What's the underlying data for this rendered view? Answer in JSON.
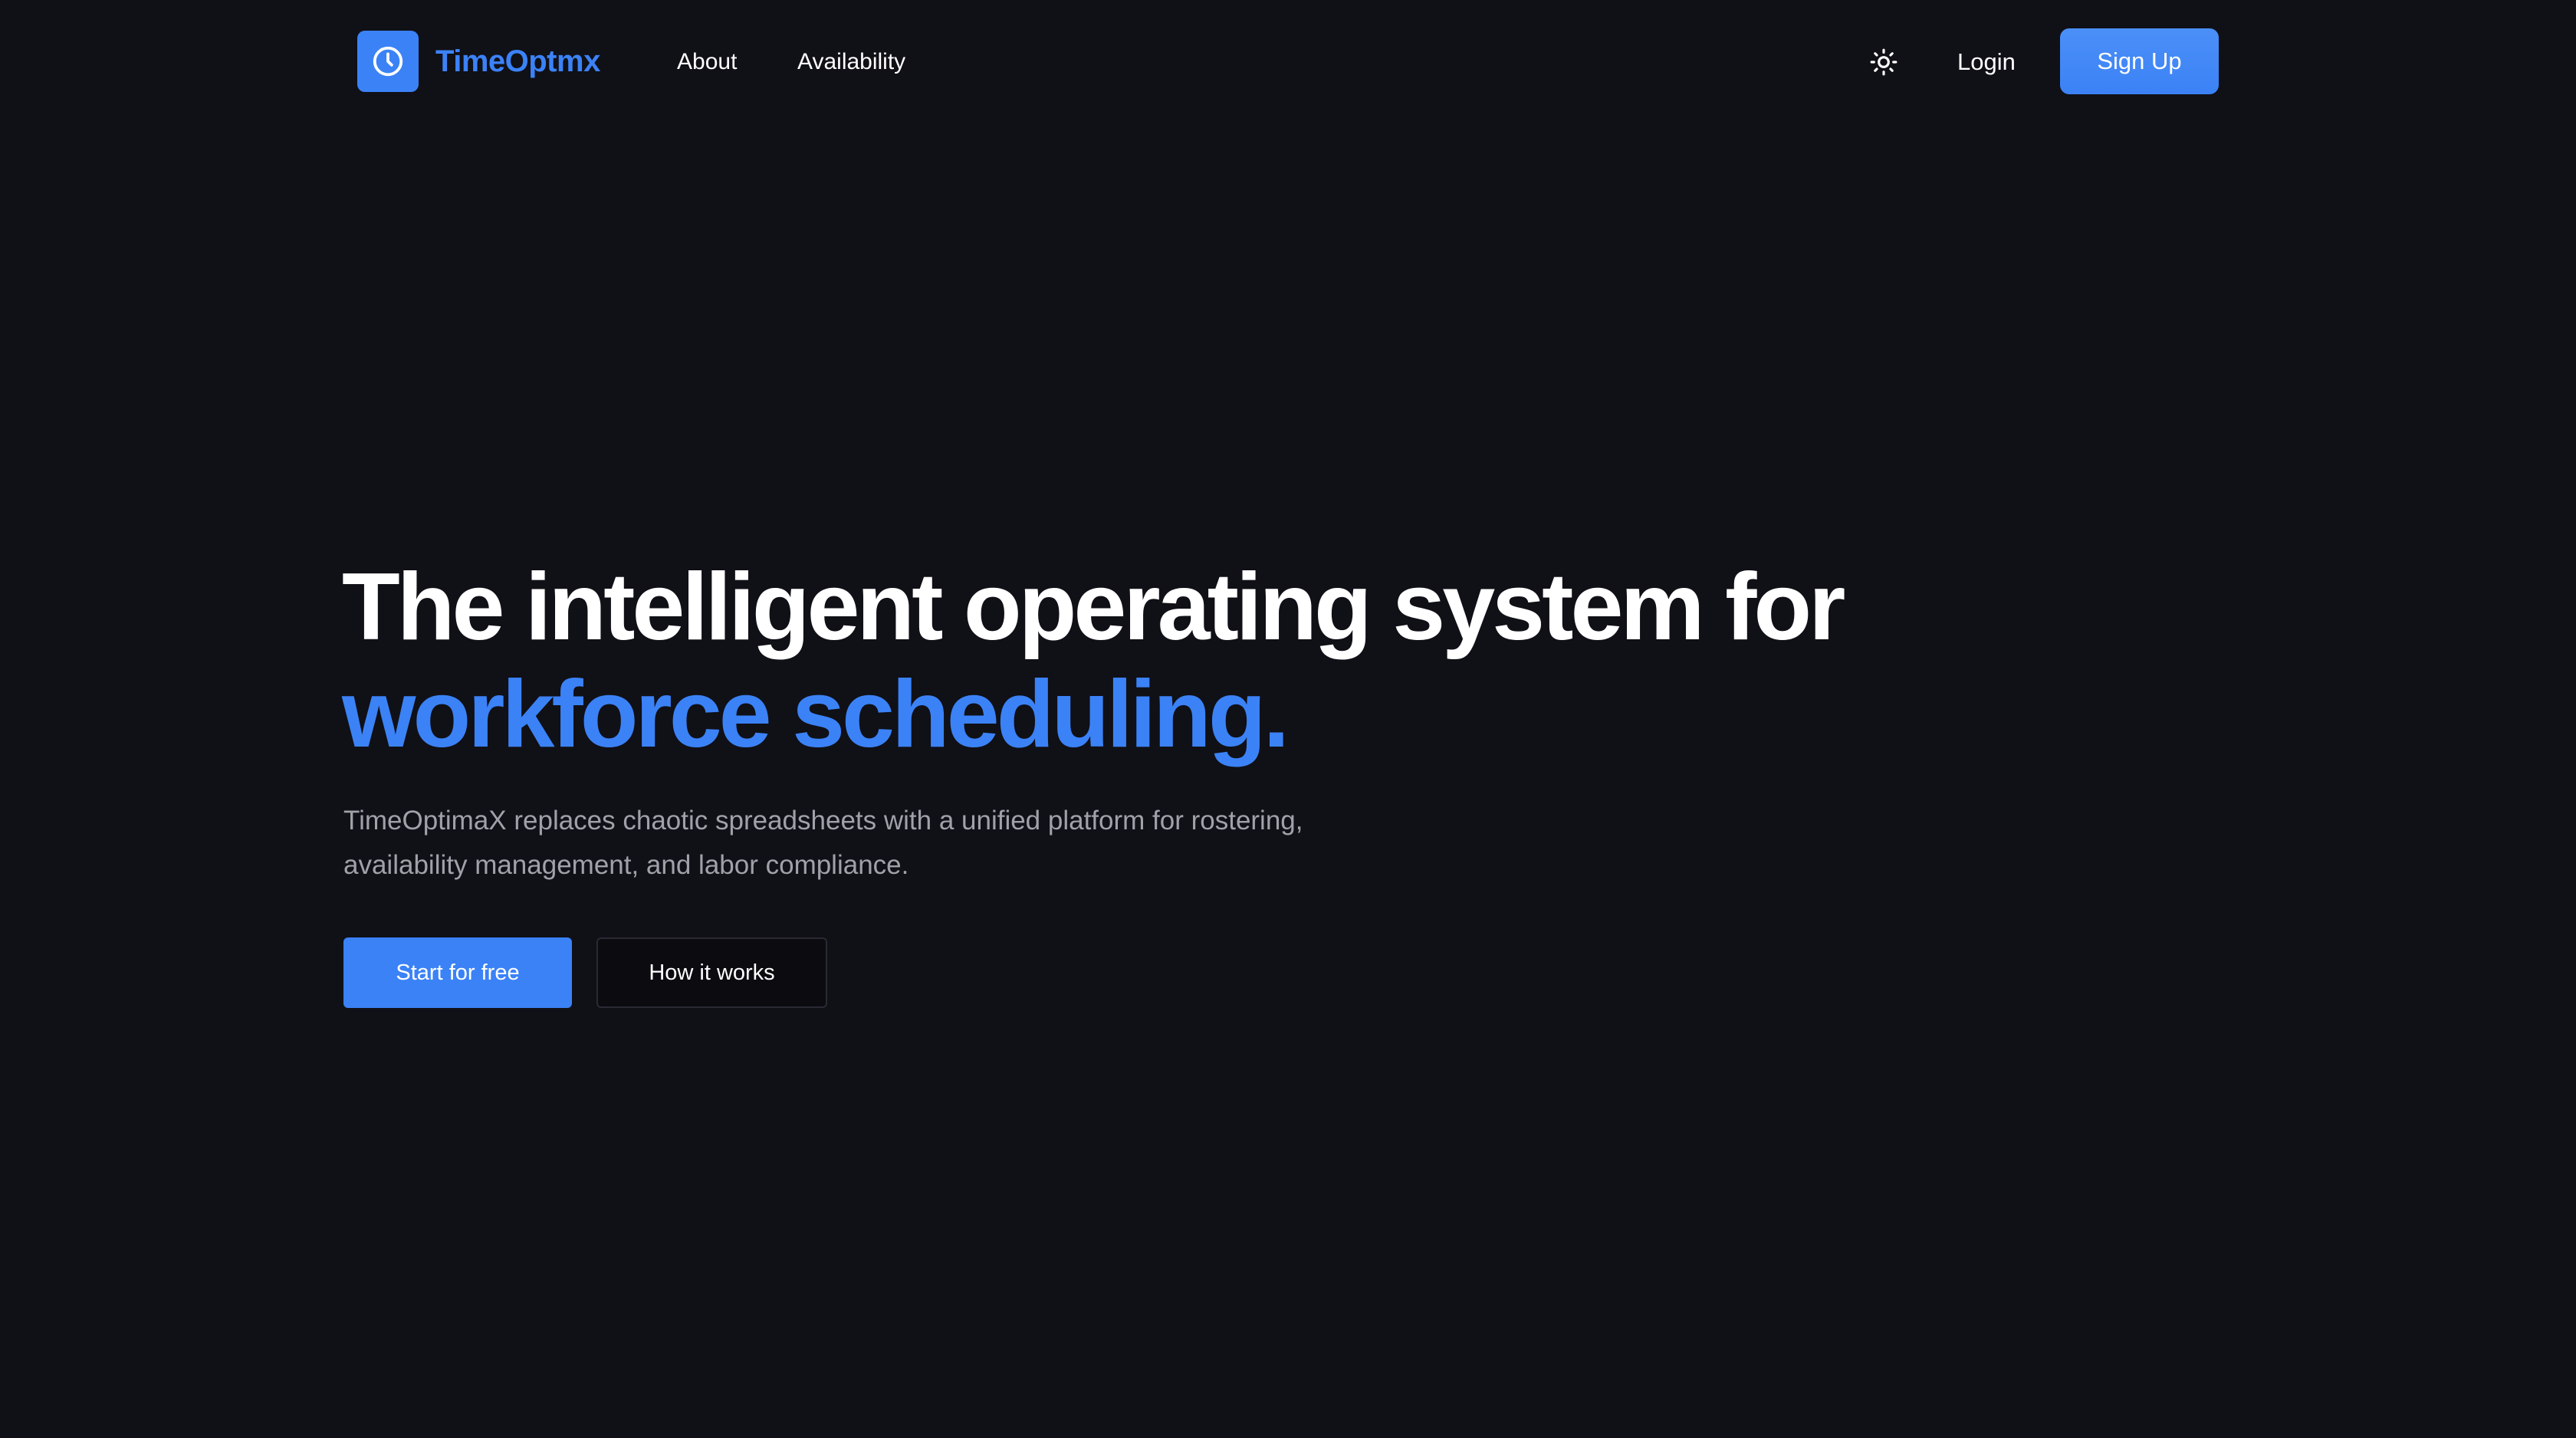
{
  "colors": {
    "background": "#101017",
    "accent": "#3b82f6",
    "text_primary": "#ffffff",
    "text_muted": "#a1a1aa",
    "secondary_button_bg": "#0b0b10",
    "secondary_button_border": "#2a2a33"
  },
  "header": {
    "brand": {
      "icon": "clock-icon",
      "name": "TimeOptmx"
    },
    "nav": [
      {
        "label": "About"
      },
      {
        "label": "Availability"
      }
    ],
    "theme_toggle_icon": "sun-icon",
    "login_label": "Login",
    "signup_label": "Sign Up"
  },
  "hero": {
    "title_line1": "The intelligent operating system for",
    "title_line2": "workforce scheduling.",
    "subtitle_line1": "TimeOptimaX replaces chaotic spreadsheets with a unified platform for rostering,",
    "subtitle_line2": "availability management, and labor compliance.",
    "primary_cta": "Start for free",
    "secondary_cta": "How it works"
  }
}
